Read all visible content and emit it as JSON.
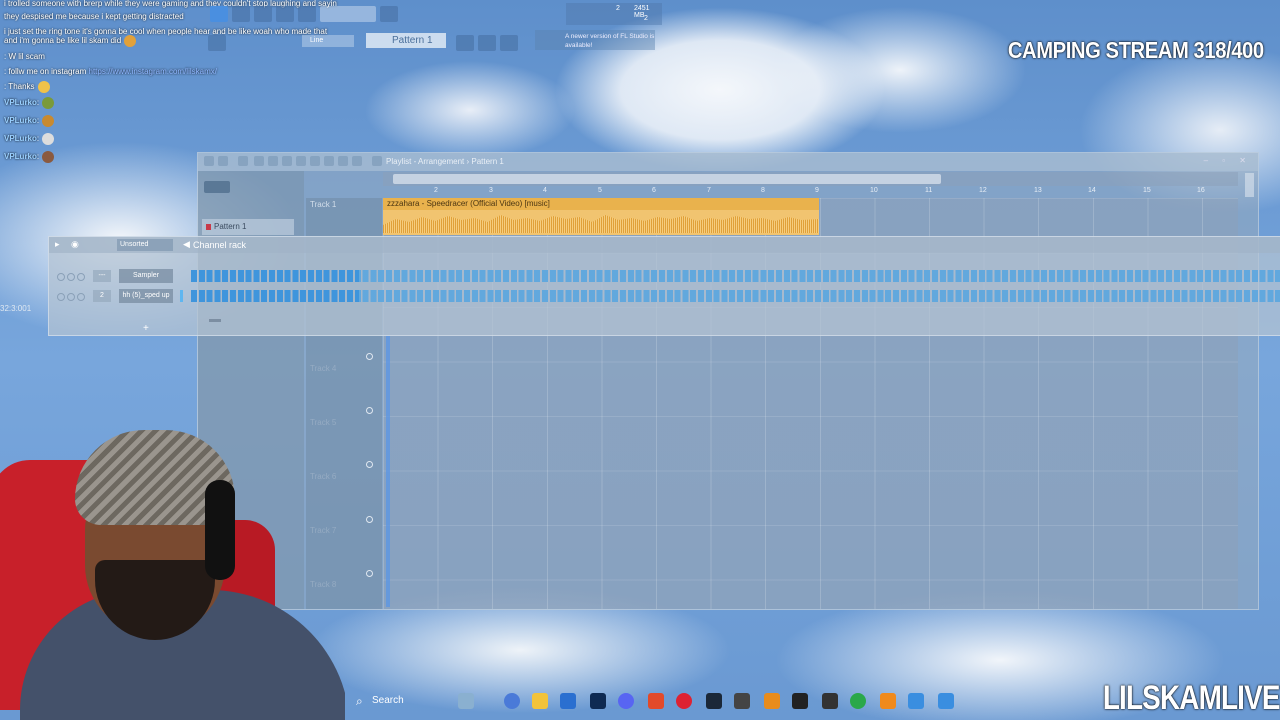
{
  "chat": [
    {
      "user": "",
      "text": "i trolled someone with brerp while they were gaming and they couldn't stop laughing and sayin"
    },
    {
      "user": "",
      "text": "they despised me because i kept getting distracted"
    },
    {
      "user": "",
      "text": "i just set the ring tone it's gonna be cool when people hear and be like woah who made that"
    },
    {
      "user": "",
      "text": "and i'm gonna be like lil skam did"
    },
    {
      "user": "",
      "text": ": W lil scam"
    },
    {
      "user": "",
      "text": ": follw me on instagram",
      "link": "https://www.instagram.com/lilskamx/"
    },
    {
      "user": "",
      "text": ": Thanks"
    },
    {
      "user": "VPLurko",
      "text": ":"
    },
    {
      "user": "VPLurko",
      "text": ":"
    },
    {
      "user": "VPLurko",
      "text": ":"
    },
    {
      "user": "VPLurko",
      "text": ":"
    }
  ],
  "daw": {
    "line_mode": "Line",
    "pattern_selector": "Pattern 1",
    "cpu": {
      "value": "2",
      "memory": "2451 MB",
      "poly": "2"
    },
    "update_hint": "A newer version of FL Studio is available!",
    "position": "32:3:001"
  },
  "playlist": {
    "title": "Playlist - Arrangement › Pattern 1",
    "pattern_item": "Pattern 1",
    "ruler": [
      "2",
      "3",
      "4",
      "5",
      "6",
      "7",
      "8",
      "9",
      "10",
      "11",
      "12",
      "13",
      "14",
      "15",
      "16"
    ],
    "tracks": [
      "Track 1",
      "Track 4",
      "Track 5",
      "Track 6",
      "Track 7",
      "Track 8"
    ],
    "clip_label": "zzzahara - Speedracer (Official Video) [music]"
  },
  "channel_rack": {
    "title": "Channel rack",
    "filter": "Unsorted",
    "channels": [
      {
        "num": "---",
        "name": "Sampler"
      },
      {
        "num": "2",
        "name": "hh (5)_sped up"
      }
    ],
    "add_label": "+"
  },
  "overlay": {
    "stream_title": "CAMPING STREAM 318/400",
    "brand": "LILSKAMLIVE"
  },
  "taskbar": {
    "search_label": "Search"
  },
  "colors": {
    "clip": "#f1c470",
    "step_active": "#3f95dc",
    "accent": "#4a8fe0"
  }
}
